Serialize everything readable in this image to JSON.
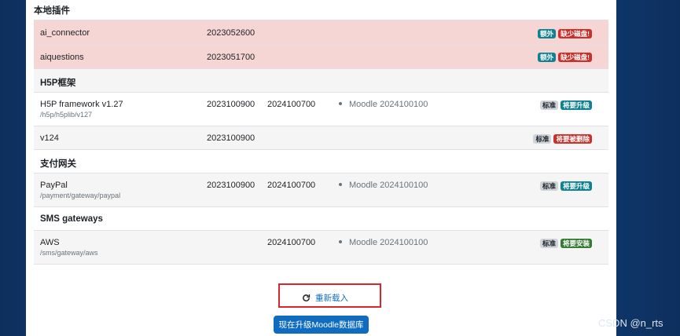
{
  "sections": {
    "local": "本地插件",
    "h5p": "H5P框架",
    "payment": "支付网关",
    "sms": "SMS gateways"
  },
  "rows": [
    {
      "name": "ai_connector",
      "path": "",
      "version": "2023052600",
      "new_version": "",
      "dependency": "",
      "badges": [
        "额外",
        "缺少磁盘!"
      ]
    },
    {
      "name": "aiquestions",
      "path": "",
      "version": "2023051700",
      "new_version": "",
      "dependency": "",
      "badges": [
        "额外",
        "缺少磁盘!"
      ]
    },
    {
      "name": "H5P framework v1.27",
      "path": "/h5p/h5plib/v127",
      "version": "2023100900",
      "new_version": "2024100700",
      "dependency": "Moodle 2024100100",
      "badges": [
        "标准",
        "将要升级"
      ]
    },
    {
      "name": "v124",
      "path": "",
      "version": "2023100900",
      "new_version": "",
      "dependency": "",
      "badges": [
        "标准",
        "将要被删除"
      ]
    },
    {
      "name": "PayPal",
      "path": "/payment/gateway/paypal",
      "version": "2023100900",
      "new_version": "2024100700",
      "dependency": "Moodle 2024100100",
      "badges": [
        "标准",
        "将要升级"
      ]
    },
    {
      "name": "AWS",
      "path": "/sms/gateway/aws",
      "version": "",
      "new_version": "2024100700",
      "dependency": "Moodle 2024100100",
      "badges": [
        "标准",
        "将要安装"
      ]
    }
  ],
  "actions": {
    "reload_label": "重新载入",
    "upgrade_label": "现在升级Moodle数据库"
  },
  "watermark": "CSDN @n_rts",
  "colors": {
    "warning_row": "#f5d6d4",
    "primary": "#0f6cbf",
    "badge_info": "#0f8292",
    "badge_danger": "#c9302c",
    "badge_success": "#357a32",
    "highlight_border": "#d9262a"
  }
}
